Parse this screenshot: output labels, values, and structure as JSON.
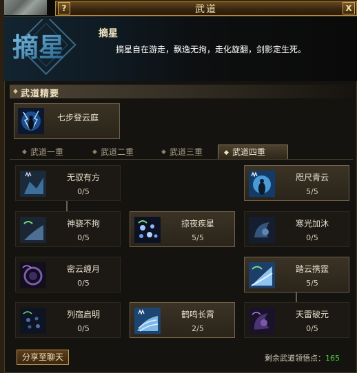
{
  "window": {
    "title": "武道",
    "help_label": "?",
    "close_label": "X"
  },
  "header": {
    "emblem_text": "摘星",
    "skill_name": "摘星",
    "description": "摘星自在游走，飘逸无拘，走化旋翻，剑影定生死。"
  },
  "section": {
    "title": "武道精要"
  },
  "top_skill": {
    "name": "七步登云庭",
    "icon": "lightning-figure-icon"
  },
  "tabs": [
    {
      "label": "武道一重",
      "active": false
    },
    {
      "label": "武道二重",
      "active": false
    },
    {
      "label": "武道三重",
      "active": false
    },
    {
      "label": "武道四重",
      "active": true
    }
  ],
  "skills": [
    {
      "name": "无驭有方",
      "level": "0/5",
      "learned": false,
      "icon": "crown-hand-icon"
    },
    {
      "name": "咫尺青云",
      "level": "5/5",
      "learned": true,
      "icon": "crown-figure-icon"
    },
    {
      "name": "神骁不拘",
      "level": "0/5",
      "learned": false,
      "icon": "crescent-swirl-icon"
    },
    {
      "name": "掠夜疾星",
      "level": "5/5",
      "learned": true,
      "icon": "star-orbs-icon"
    },
    {
      "name": "寒光加沐",
      "level": "0/5",
      "learned": false,
      "icon": "blue-swirl-icon"
    },
    {
      "name": "密云缠月",
      "level": "0/5",
      "learned": false,
      "icon": "purple-vortex-icon"
    },
    {
      "name": "踏云携霆",
      "level": "5/5",
      "learned": true,
      "icon": "crescent-wave-icon"
    },
    {
      "name": "列宿启明",
      "level": "0/5",
      "learned": false,
      "icon": "dot-cluster-icon"
    },
    {
      "name": "鹤鸣长霄",
      "level": "2/5",
      "learned": true,
      "icon": "crown-wave-icon"
    },
    {
      "name": "天雷破元",
      "level": "0/5",
      "learned": false,
      "icon": "purple-swirl-icon"
    }
  ],
  "footer": {
    "share_label": "分享至聊天",
    "remaining_label": "剩余武道领悟点：",
    "remaining_points": "165"
  },
  "colors": {
    "accent_gold": "#c69b52",
    "points_green": "#46d046"
  }
}
